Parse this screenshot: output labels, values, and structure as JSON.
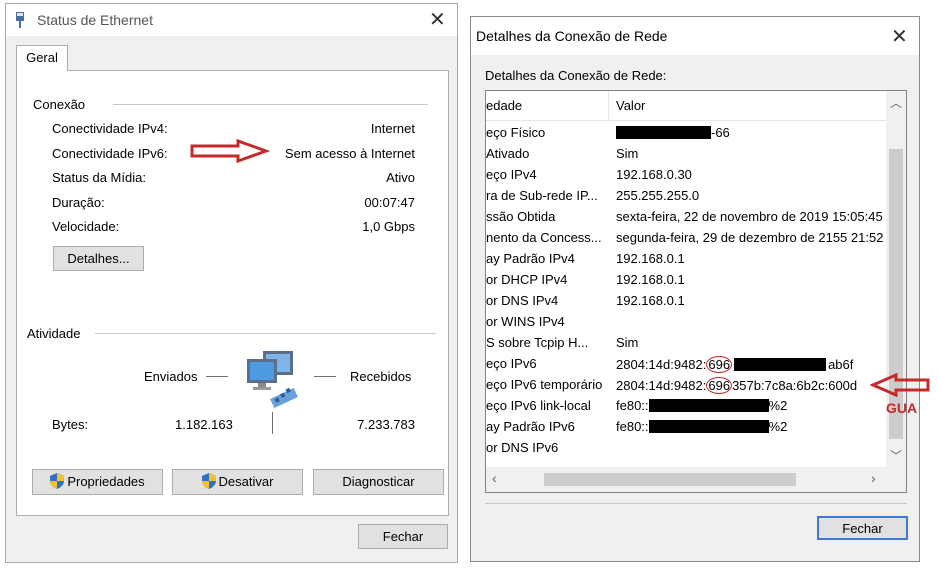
{
  "left": {
    "title": "Status de Ethernet",
    "tab": "Geral",
    "conexao": {
      "label": "Conexão",
      "rows": [
        {
          "label": "Conectividade IPv4:",
          "value": "Internet"
        },
        {
          "label": "Conectividade IPv6:",
          "value": "Sem acesso à Internet"
        },
        {
          "label": "Status da Mídia:",
          "value": "Ativo"
        },
        {
          "label": "Duração:",
          "value": "00:07:47"
        },
        {
          "label": "Velocidade:",
          "value": "1,0 Gbps"
        }
      ],
      "details_button": "Detalhes..."
    },
    "atividade": {
      "label": "Atividade",
      "sent_label": "Enviados",
      "received_label": "Recebidos",
      "bytes_label": "Bytes:",
      "bytes_sent": "1.182.163",
      "bytes_received": "7.233.783"
    },
    "buttons": {
      "properties": "Propriedades",
      "disable": "Desativar",
      "diagnose": "Diagnosticar"
    },
    "close_button": "Fechar"
  },
  "right": {
    "title": "Detalhes da Conexão de Rede",
    "section_label": "Detalhes da Conexão de Rede:",
    "columns": {
      "property": "edade",
      "value": "Valor"
    },
    "rows": [
      {
        "property": "eço Físico",
        "value": "-66"
      },
      {
        "property": " Ativado",
        "value": "Sim"
      },
      {
        "property": "eço IPv4",
        "value": "192.168.0.30"
      },
      {
        "property": "ra de Sub-rede IP...",
        "value": "255.255.255.0"
      },
      {
        "property": "ssão Obtida",
        "value": "sexta-feira, 22 de novembro de 2019 15:05:45"
      },
      {
        "property": "nento da Concess...",
        "value": "segunda-feira, 29 de dezembro de 2155 21:52"
      },
      {
        "property": "ay Padrão IPv4",
        "value": "192.168.0.1"
      },
      {
        "property": "or DHCP IPv4",
        "value": "192.168.0.1"
      },
      {
        "property": "or DNS IPv4",
        "value": "192.168.0.1"
      },
      {
        "property": "or WINS IPv4",
        "value": ""
      },
      {
        "property": "S sobre Tcpip H...",
        "value": "Sim"
      },
      {
        "property": "eço IPv6",
        "value_prefix": "2804:14d:9482:",
        "value_circled": "696",
        "value_suffix": "ab6f"
      },
      {
        "property": "eço IPv6 temporário",
        "value_prefix": "2804:14d:9482:",
        "value_circled": "696",
        "value_suffix": "357b:7c8a:6b2c:600d"
      },
      {
        "property": "eço IPv6 link-local",
        "value_prefix": "fe80::",
        "value_suffix": "%2"
      },
      {
        "property": "ay Padrão IPv6",
        "value_prefix": "fe80::",
        "value_suffix": "%2"
      },
      {
        "property": "or DNS IPv6",
        "value": ""
      }
    ],
    "close_button": "Fechar",
    "annotation": "GUA"
  },
  "colors": {
    "annotation_red": "#c32b2b",
    "button_face": "#e1e1e1",
    "window_bg": "#f0f0f0"
  }
}
